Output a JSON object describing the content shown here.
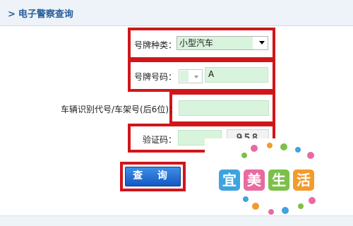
{
  "header": {
    "arrow": ">",
    "title": "电子警察查询"
  },
  "form": {
    "plate_type": {
      "label": "号牌种类：",
      "value": "小型汽车"
    },
    "plate_number": {
      "label": "号牌号码：",
      "value": "A"
    },
    "vin": {
      "label": "车辆识别代号/车架号(后6位)：",
      "value": ""
    },
    "captcha": {
      "label": "验证码：",
      "value": "",
      "image_text": "958"
    },
    "submit_label": "查 询"
  },
  "watermark": {
    "letters": [
      "宜",
      "美",
      "生",
      "活"
    ],
    "colors": [
      "#3fa3e0",
      "#e86aa0",
      "#7cc04a",
      "#f29b2c"
    ]
  }
}
